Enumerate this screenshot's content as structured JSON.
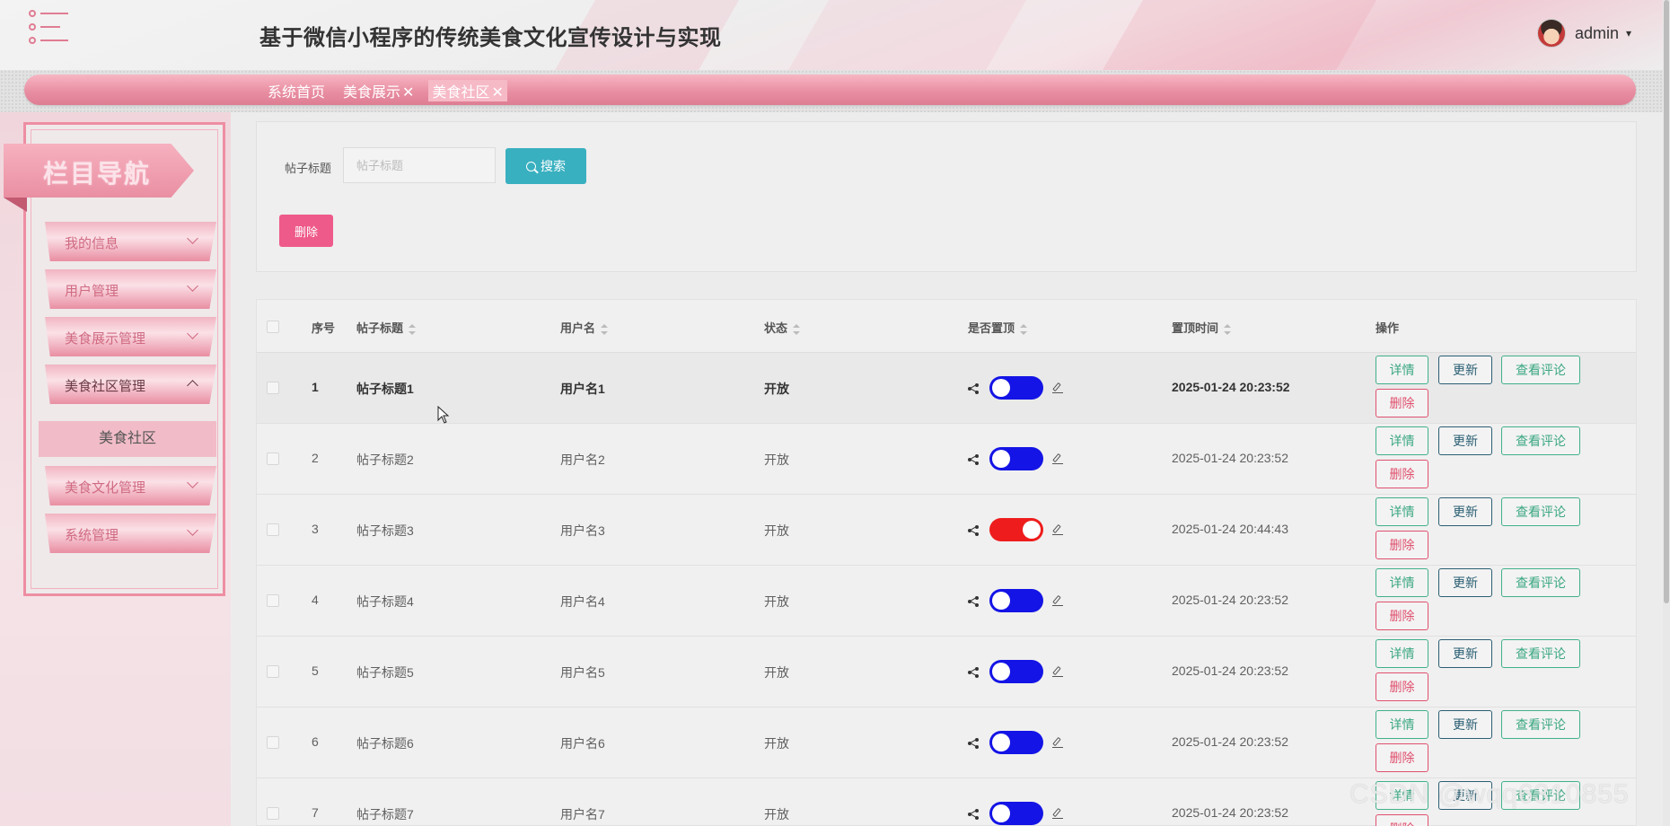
{
  "header": {
    "title": "基于微信小程序的传统美食文化宣传设计与实现",
    "user": {
      "name": "admin",
      "caret": "▾"
    }
  },
  "breadcrumbs": [
    {
      "label": "系统首页",
      "closable": false
    },
    {
      "label": "美食展示",
      "closable": true
    },
    {
      "label": "美食社区",
      "closable": true,
      "active": true
    }
  ],
  "close_glyph": "✕",
  "sidebar": {
    "banner": "栏目导航",
    "items": [
      {
        "label": "我的信息",
        "open": false
      },
      {
        "label": "用户管理",
        "open": false
      },
      {
        "label": "美食展示管理",
        "open": false
      },
      {
        "label": "美食社区管理",
        "open": true
      },
      {
        "label": "美食文化管理",
        "open": false
      },
      {
        "label": "系统管理",
        "open": false
      }
    ],
    "sub_item": "美食社区"
  },
  "search": {
    "label": "帖子标题",
    "placeholder": "帖子标题",
    "value": "",
    "button": "搜索"
  },
  "bulk_delete": "删除",
  "table": {
    "columns": {
      "index": "序号",
      "title": "帖子标题",
      "username": "用户名",
      "status": "状态",
      "pinned": "是否置顶",
      "pin_time": "置顶时间",
      "actions": "操作"
    },
    "rows": [
      {
        "index": "1",
        "title": "帖子标题1",
        "username": "用户名1",
        "status": "开放",
        "pinned": false,
        "pin_time": "2025-01-24 20:23:52"
      },
      {
        "index": "2",
        "title": "帖子标题2",
        "username": "用户名2",
        "status": "开放",
        "pinned": false,
        "pin_time": "2025-01-24 20:23:52"
      },
      {
        "index": "3",
        "title": "帖子标题3",
        "username": "用户名3",
        "status": "开放",
        "pinned": true,
        "pin_time": "2025-01-24 20:44:43"
      },
      {
        "index": "4",
        "title": "帖子标题4",
        "username": "用户名4",
        "status": "开放",
        "pinned": false,
        "pin_time": "2025-01-24 20:23:52"
      },
      {
        "index": "5",
        "title": "帖子标题5",
        "username": "用户名5",
        "status": "开放",
        "pinned": false,
        "pin_time": "2025-01-24 20:23:52"
      },
      {
        "index": "6",
        "title": "帖子标题6",
        "username": "用户名6",
        "status": "开放",
        "pinned": false,
        "pin_time": "2025-01-24 20:23:52"
      },
      {
        "index": "7",
        "title": "帖子标题7",
        "username": "用户名7",
        "status": "开放",
        "pinned": false,
        "pin_time": "2025-01-24 20:23:52"
      }
    ],
    "actions": {
      "detail": "详情",
      "update": "更新",
      "comments": "查看评论",
      "delete": "删除"
    }
  },
  "colors": {
    "toggle_off": "#1414e6",
    "toggle_on": "#ee1c1c",
    "accent_pink": "#e98fa3",
    "search_button": "#39b0c0"
  },
  "watermark": "CSDN @wqq6310855"
}
